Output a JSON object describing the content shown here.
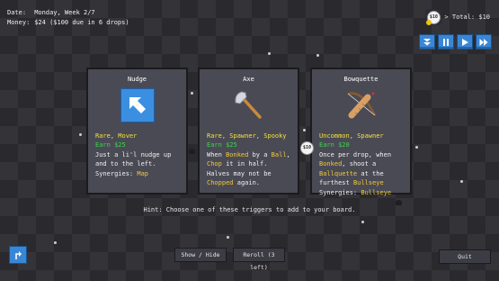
{
  "hud": {
    "date_label": "Date:",
    "date_value": "Monday, Week 2/7",
    "money_label": "Money:",
    "money_value": "$24 ($100 due in 6 drops)",
    "gem_value": "$10",
    "total_text": "> Total: $10"
  },
  "controls": [
    {
      "name": "fast-drop",
      "glyph": "⏬"
    },
    {
      "name": "pause",
      "glyph": "❚❚"
    },
    {
      "name": "play",
      "glyph": "▶"
    },
    {
      "name": "fast-forward",
      "glyph": "⏩"
    }
  ],
  "cards": [
    {
      "title": "Nudge",
      "icon": "up-left-arrow-icon",
      "tags": "Rare, Mover",
      "earn": "Earn $25",
      "desc": "Just a li'l nudge up and to the left.",
      "synergies_label": "Synergies:",
      "synergies": "Map"
    },
    {
      "title": "Axe",
      "icon": "axe-icon",
      "tags": "Rare, Spawner, Spooky",
      "earn": "Earn $25",
      "desc_parts": [
        "When ",
        "Bonked",
        " by a ",
        "Ball",
        ", ",
        "Chop",
        " it in half. Halves may not be ",
        "Chopped",
        " again."
      ],
      "synergies_label": "",
      "synergies": ""
    },
    {
      "title": "Bowquette",
      "icon": "bowquette-icon",
      "tags": "Uncommon, Spawner",
      "earn": "Earn $20",
      "desc_parts": [
        "Once per drop, when ",
        "Bonked",
        ", shoot a ",
        "Ballquette",
        " at the furthest ",
        "Bullseye"
      ],
      "synergies_label": "Synergies:",
      "synergies": "Bullseye"
    }
  ],
  "mid_coin": "$10",
  "hint": "Hint: Choose one of these triggers to add to your board.",
  "buttons": {
    "show_hide": "Show / Hide",
    "reroll": "Reroll (3 left)",
    "quit": "Quit"
  },
  "colors": {
    "accent_blue": "#3a86d6",
    "tag_yellow": "#f1e33a",
    "earn_green": "#3bd64a",
    "keyword_gold": "#f1c93a",
    "card_bg": "#4a4a55"
  }
}
